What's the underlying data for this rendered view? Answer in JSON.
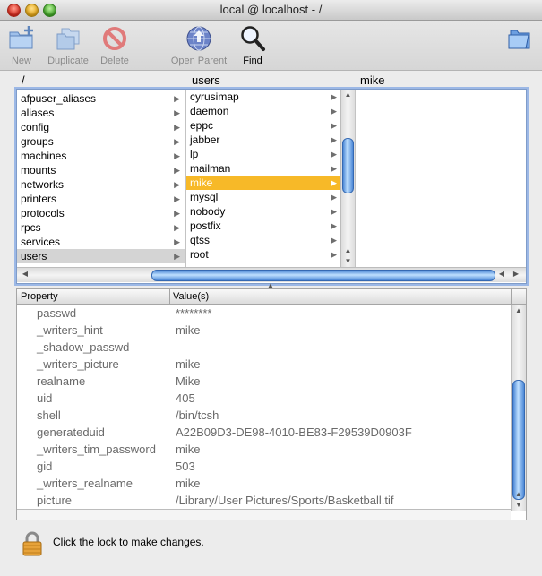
{
  "window": {
    "title": "local @ localhost - /"
  },
  "toolbar": {
    "new_label": "New",
    "duplicate_label": "Duplicate",
    "delete_label": "Delete",
    "open_parent_label": "Open Parent",
    "find_label": "Find"
  },
  "browser": {
    "col1_header": "/",
    "col2_header": "users",
    "col3_header": "mike",
    "col1_items": [
      "afpuser_aliases",
      "aliases",
      "config",
      "groups",
      "machines",
      "mounts",
      "networks",
      "printers",
      "protocols",
      "rpcs",
      "services",
      "users"
    ],
    "col2_items": [
      "cyrusimap",
      "daemon",
      "eppc",
      "jabber",
      "lp",
      "mailman",
      "mike",
      "mysql",
      "nobody",
      "postfix",
      "qtss",
      "root"
    ],
    "col1_selected": "users",
    "col2_selected": "mike"
  },
  "properties": {
    "header_property": "Property",
    "header_values": "Value(s)",
    "rows": [
      {
        "key": "passwd",
        "value": "********"
      },
      {
        "key": "_writers_hint",
        "value": "mike"
      },
      {
        "key": "_shadow_passwd",
        "value": ""
      },
      {
        "key": "_writers_picture",
        "value": "mike"
      },
      {
        "key": "realname",
        "value": "Mike"
      },
      {
        "key": "uid",
        "value": "405"
      },
      {
        "key": "shell",
        "value": "/bin/tcsh"
      },
      {
        "key": "generateduid",
        "value": "A22B09D3-DE98-4010-BE83-F29539D0903F"
      },
      {
        "key": "_writers_tim_password",
        "value": "mike"
      },
      {
        "key": "gid",
        "value": "503"
      },
      {
        "key": "_writers_realname",
        "value": "mike"
      },
      {
        "key": "picture",
        "value": "/Library/User Pictures/Sports/Basketball.tif"
      }
    ]
  },
  "lock": {
    "message": "Click the lock to make changes."
  },
  "colors": {
    "selection_orange": "#f7b928",
    "scroll_blue": "#4b87d6"
  }
}
